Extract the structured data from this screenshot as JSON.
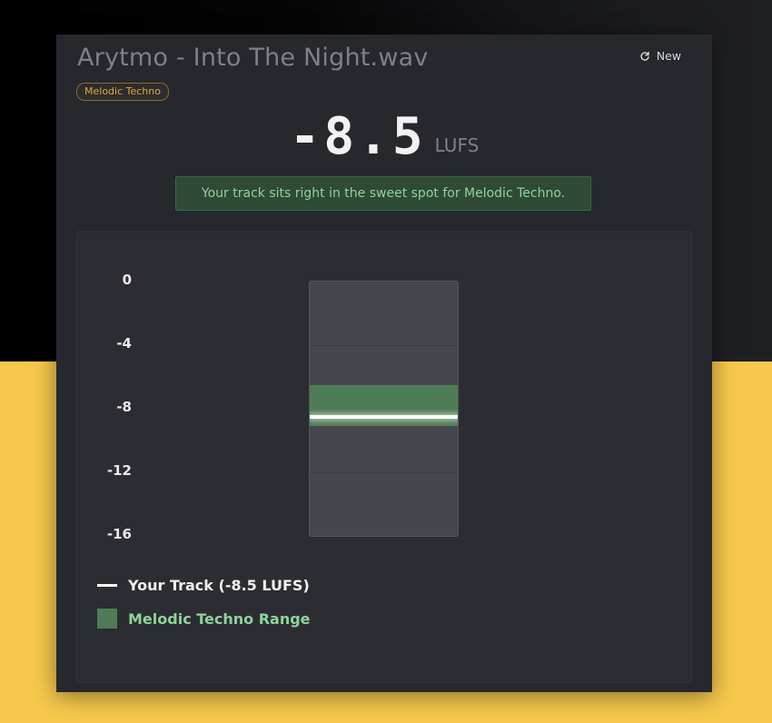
{
  "header": {
    "file_name": "Arytmo - Into The Night.wav",
    "new_label": "New",
    "genre": "Melodic Techno"
  },
  "readout": {
    "value": "-8.5",
    "unit": "LUFS"
  },
  "status_message": "Your track sits right in the sweet spot for Melodic Techno.",
  "meter": {
    "scale_max": 0,
    "scale_min": -16,
    "ticks": [
      "0",
      "-4",
      "-8",
      "-12",
      "-16"
    ],
    "track_lufs": -8.5,
    "range_top": -6.5,
    "range_bottom": -9.1
  },
  "legend": {
    "track_label": "Your Track (-8.5 LUFS)",
    "range_label": "Melodic Techno Range"
  },
  "colors": {
    "accent_green": "#4f7c56",
    "status_text": "#8fd39c",
    "badge": "#e0a63a",
    "background_yellow": "#f6c84c"
  },
  "icons": {
    "new": "refresh-icon"
  }
}
